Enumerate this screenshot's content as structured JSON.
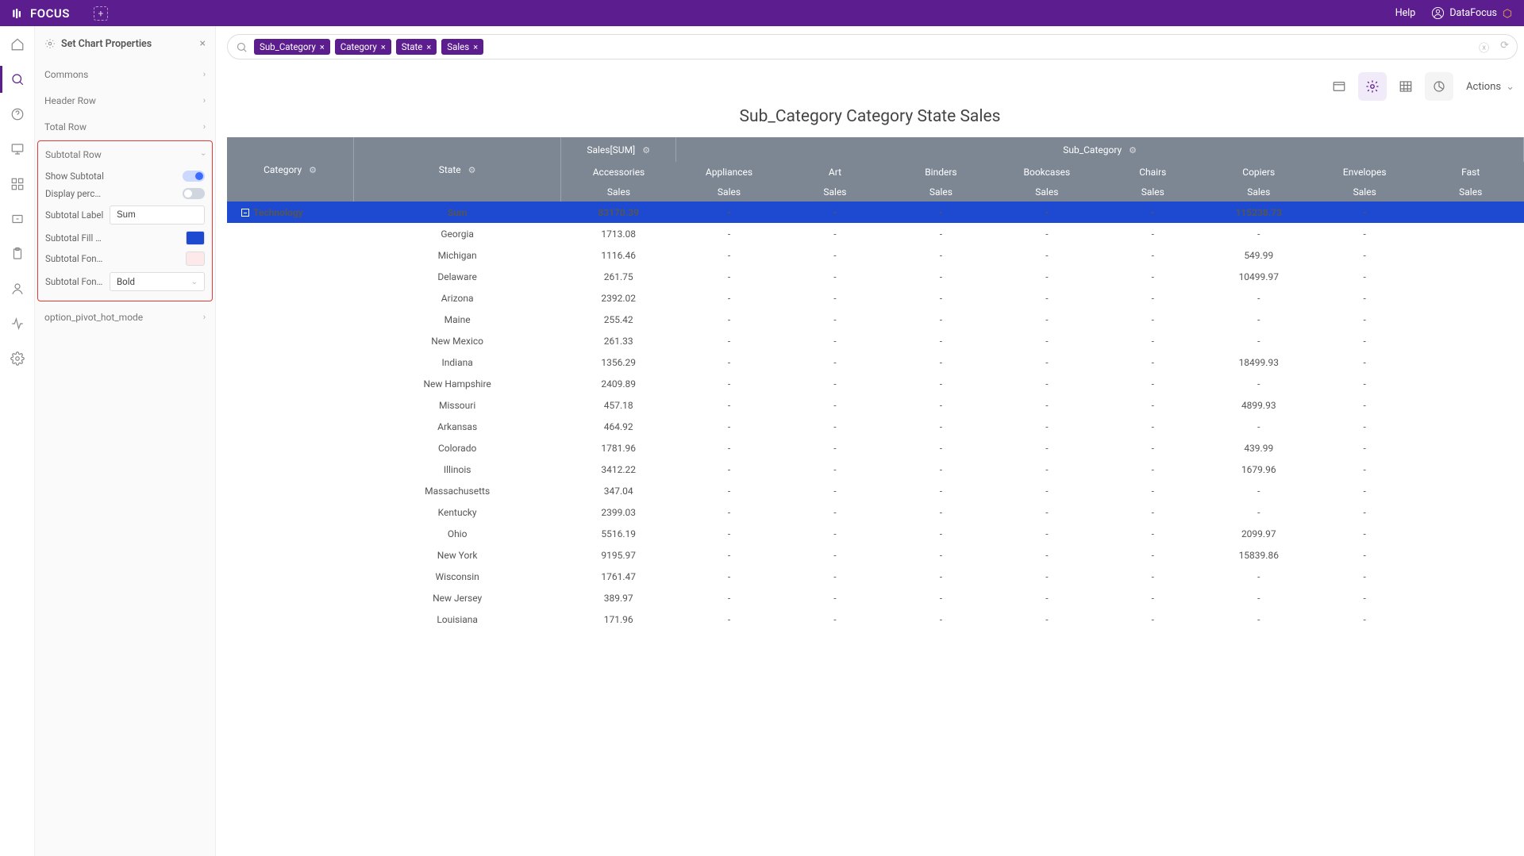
{
  "app": {
    "name": "FOCUS",
    "help": "Help",
    "user": "DataFocus"
  },
  "search": {
    "tags": [
      "Sub_Category",
      "Category",
      "State",
      "Sales"
    ]
  },
  "toolbar": {
    "actions": "Actions"
  },
  "props": {
    "title": "Set Chart Properties",
    "sections": {
      "commons": "Commons",
      "header_row": "Header Row",
      "total_row": "Total Row",
      "subtotal_row": "Subtotal Row",
      "pivot_hot": "option_pivot_hot_mode"
    },
    "subtotal": {
      "show_subtotal": "Show Subtotal",
      "display_pct": "Display percen...",
      "label_label": "Subtotal Label",
      "label_value": "Sum",
      "fill_label": "Subtotal Fill C...",
      "fill_value": "#1e4ad1",
      "font_color_label": "Subtotal Font ...",
      "font_color_value": "#fde9ea",
      "font_weight_label": "Subtotal Font ...",
      "font_weight_value": "Bold"
    }
  },
  "chart": {
    "title": "Sub_Category Category State Sales",
    "band_sales": "Sales[SUM]",
    "band_subcat": "Sub_Category",
    "col_category": "Category",
    "col_state": "State",
    "sub_cols": [
      "Accessories",
      "Appliances",
      "Art",
      "Binders",
      "Bookcases",
      "Chairs",
      "Copiers",
      "Envelopes",
      "Fast"
    ],
    "sales_label": "Sales",
    "subtotal_category": "Technology",
    "subtotal_label": "Sum",
    "subtotal_values": [
      "83170.39",
      "-",
      "-",
      "-",
      "-",
      "-",
      "115238.73",
      "-",
      ""
    ],
    "rows": [
      {
        "state": "Georgia",
        "vals": [
          "1713.08",
          "-",
          "-",
          "-",
          "-",
          "-",
          "-",
          "-",
          ""
        ]
      },
      {
        "state": "Michigan",
        "vals": [
          "1116.46",
          "-",
          "-",
          "-",
          "-",
          "-",
          "549.99",
          "-",
          ""
        ]
      },
      {
        "state": "Delaware",
        "vals": [
          "261.75",
          "-",
          "-",
          "-",
          "-",
          "-",
          "10499.97",
          "-",
          ""
        ]
      },
      {
        "state": "Arizona",
        "vals": [
          "2392.02",
          "-",
          "-",
          "-",
          "-",
          "-",
          "-",
          "-",
          ""
        ]
      },
      {
        "state": "Maine",
        "vals": [
          "255.42",
          "-",
          "-",
          "-",
          "-",
          "-",
          "-",
          "-",
          ""
        ]
      },
      {
        "state": "New Mexico",
        "vals": [
          "261.33",
          "-",
          "-",
          "-",
          "-",
          "-",
          "-",
          "-",
          ""
        ]
      },
      {
        "state": "Indiana",
        "vals": [
          "1356.29",
          "-",
          "-",
          "-",
          "-",
          "-",
          "18499.93",
          "-",
          ""
        ]
      },
      {
        "state": "New Hampshire",
        "vals": [
          "2409.89",
          "-",
          "-",
          "-",
          "-",
          "-",
          "-",
          "-",
          ""
        ]
      },
      {
        "state": "Missouri",
        "vals": [
          "457.18",
          "-",
          "-",
          "-",
          "-",
          "-",
          "4899.93",
          "-",
          ""
        ]
      },
      {
        "state": "Arkansas",
        "vals": [
          "464.92",
          "-",
          "-",
          "-",
          "-",
          "-",
          "-",
          "-",
          ""
        ]
      },
      {
        "state": "Colorado",
        "vals": [
          "1781.96",
          "-",
          "-",
          "-",
          "-",
          "-",
          "439.99",
          "-",
          ""
        ]
      },
      {
        "state": "Illinois",
        "vals": [
          "3412.22",
          "-",
          "-",
          "-",
          "-",
          "-",
          "1679.96",
          "-",
          ""
        ]
      },
      {
        "state": "Massachusetts",
        "vals": [
          "347.04",
          "-",
          "-",
          "-",
          "-",
          "-",
          "-",
          "-",
          ""
        ]
      },
      {
        "state": "Kentucky",
        "vals": [
          "2399.03",
          "-",
          "-",
          "-",
          "-",
          "-",
          "-",
          "-",
          ""
        ]
      },
      {
        "state": "Ohio",
        "vals": [
          "5516.19",
          "-",
          "-",
          "-",
          "-",
          "-",
          "2099.97",
          "-",
          ""
        ]
      },
      {
        "state": "New York",
        "vals": [
          "9195.97",
          "-",
          "-",
          "-",
          "-",
          "-",
          "15839.86",
          "-",
          ""
        ]
      },
      {
        "state": "Wisconsin",
        "vals": [
          "1761.47",
          "-",
          "-",
          "-",
          "-",
          "-",
          "-",
          "-",
          ""
        ]
      },
      {
        "state": "New Jersey",
        "vals": [
          "389.97",
          "-",
          "-",
          "-",
          "-",
          "-",
          "-",
          "-",
          ""
        ]
      },
      {
        "state": "Louisiana",
        "vals": [
          "171.96",
          "-",
          "-",
          "-",
          "-",
          "-",
          "-",
          "-",
          ""
        ]
      }
    ]
  }
}
